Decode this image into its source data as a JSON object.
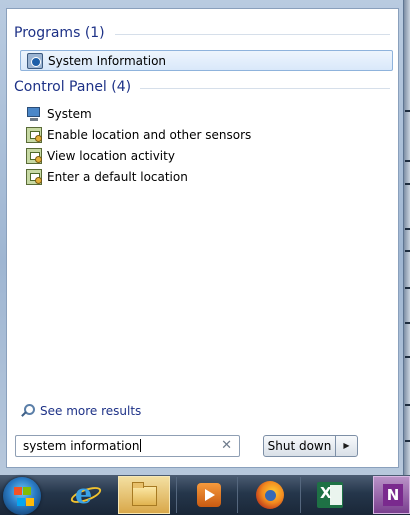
{
  "start_menu": {
    "programs_header": "Programs (1)",
    "programs": [
      {
        "label": "System Information",
        "icon": "system-information-icon",
        "selected": true
      }
    ],
    "control_panel_header": "Control Panel (4)",
    "control_panel": [
      {
        "label": "System",
        "icon": "system-icon"
      },
      {
        "label": "Enable location and other sensors",
        "icon": "location-sensors-icon"
      },
      {
        "label": "View location activity",
        "icon": "location-sensors-icon"
      },
      {
        "label": "Enter a default location",
        "icon": "location-sensors-icon"
      }
    ],
    "see_more": "See more results",
    "search": {
      "value": "system information"
    },
    "shutdown_label": "Shut down"
  },
  "taskbar": {
    "apps": [
      "start-orb",
      "internet-explorer",
      "windows-explorer",
      "windows-media-player",
      "firefox",
      "excel",
      "onenote"
    ],
    "excel_letter": "X",
    "onenote_letter": "N"
  },
  "colors": {
    "header_text": "#1e3287",
    "selection_border": "#8fb3dc",
    "taskbar": "#25364b"
  }
}
